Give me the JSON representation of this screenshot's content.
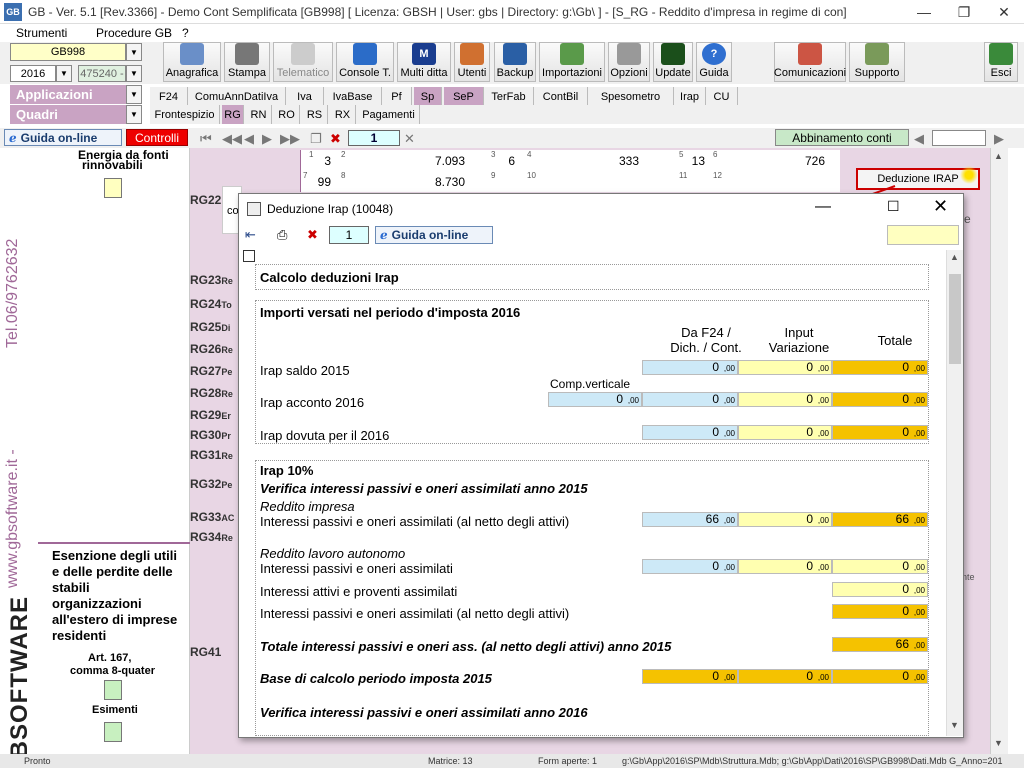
{
  "window": {
    "title": "GB - Ver. 5.1 [Rev.3366] -  Demo Cont Semplificata [GB998]     [ Licenza: GBSH | User: gbs | Directory: g:\\Gb\\ ] - [S_RG - Reddito d'impresa in regime di con]",
    "app_icon_label": "GB",
    "minimize": "—",
    "maximize": "❐",
    "close": "✕"
  },
  "menu": {
    "items": [
      "Strumenti",
      "Procedure GB",
      "?"
    ]
  },
  "left_panel": {
    "company": "GB998",
    "year": "2016",
    "code": "475240 -",
    "sections": [
      "Applicazioni",
      "Quadri"
    ]
  },
  "toolbar": {
    "buttons": [
      "Anagrafica",
      "Stampa",
      "Telematico",
      "Console T.",
      "Multi ditta",
      "Utenti",
      "Backup",
      "Importazioni",
      "Opzioni",
      "Update",
      "Guida",
      "Comunicazioni",
      "Supporto",
      "Esci"
    ]
  },
  "tabs_row1": [
    "F24",
    "ComuAnnDatiIva",
    "Iva",
    "IvaBase",
    "Pf",
    "Sp",
    "SeP",
    "TerFab",
    "ContBil",
    "Spesometro",
    "Irap",
    "CU"
  ],
  "tabs_row2": [
    "Frontespizio",
    "RG",
    "RN",
    "RO",
    "RS",
    "RX",
    "Pagamenti"
  ],
  "navbar": {
    "guida": "Guida on-line",
    "controlli": "Controlli",
    "page": "1",
    "abbinamento": "Abbinamento conti"
  },
  "brand": {
    "phone": "Tel.06/9762632",
    "site": "www.gbsoftware.it -",
    "logo": "GBSOFTWARE"
  },
  "side_panel": {
    "energia": "Energia da fonti",
    "rinnovabili": "rinnovabili",
    "esenzione": "Esenzione degli utili e delle perdite delle stabili organizzazioni all'estero di imprese residenti",
    "art": "Art. 167,",
    "comma": "comma 8-quater",
    "esimenti": "Esimenti"
  },
  "rows": {
    "rg22": "RG22",
    "rg_list": [
      {
        "code": "RG23",
        "lbl": "Re"
      },
      {
        "code": "RG24",
        "lbl": "To"
      },
      {
        "code": "RG25",
        "lbl": "Di"
      },
      {
        "code": "RG26",
        "lbl": "Re"
      },
      {
        "code": "RG27",
        "lbl": "Pe"
      },
      {
        "code": "RG28",
        "lbl": "Re"
      },
      {
        "code": "RG29",
        "lbl": "Er"
      },
      {
        "code": "RG30",
        "lbl": "Pr"
      },
      {
        "code": "RG31",
        "lbl": "Re"
      },
      {
        "code": "RG32",
        "lbl": "Pe"
      },
      {
        "code": "RG33",
        "lbl": "AC"
      },
      {
        "code": "RG34",
        "lbl": "Re"
      },
      {
        "code": "RG41",
        "lbl": ""
      }
    ],
    "grid_row1": [
      "3",
      "7.093",
      "6",
      "333",
      "13",
      "726"
    ],
    "grid_row2": [
      "99",
      "8.730",
      "",
      "",
      "",
      ""
    ],
    "sup1": [
      "1",
      "2",
      "3",
      "4",
      "5",
      "6"
    ],
    "sup2": [
      "7",
      "8",
      "9",
      "10",
      "11",
      "12"
    ],
    "co_frag": "co",
    "se_frag": "se",
    "nte_frag": "nte",
    "deduzione_btn": "Deduzione IRAP"
  },
  "dialog": {
    "title": "Deduzione Irap (10048)",
    "page": "1",
    "guida": "Guida on-line",
    "heading": "Calcolo deduzioni Irap",
    "importi_title": "Importi versati nel periodo d'imposta 2016",
    "col_f24": "Da F24 /",
    "col_f24b": "Dich. / Cont.",
    "col_input": "Input",
    "col_inputb": "Variazione",
    "col_totale": "Totale",
    "comp_verticale": "Comp.verticale",
    "irap_saldo": {
      "label": "Irap saldo 2015",
      "f24": "0",
      "input": "0",
      "tot": "0"
    },
    "irap_acconto": {
      "label": "Irap acconto 2016",
      "comp": "0",
      "f24": "0",
      "input": "0",
      "tot": "0"
    },
    "irap_dovuta": {
      "label": "Irap dovuta per il 2016",
      "f24": "0",
      "input": "0",
      "tot": "0"
    },
    "irap10": "Irap 10%",
    "verifica2015": "Verifica interessi passivi e oneri assimilati anno 2015",
    "reddito_impresa": "Reddito impresa",
    "int_netto": {
      "label": "Interessi passivi e oneri assimilati (al netto degli attivi)",
      "f24": "66",
      "input": "0",
      "tot": "66"
    },
    "reddito_lavoro": "Reddito lavoro autonomo",
    "int_pass": {
      "label": "Interessi passivi e oneri assimilati",
      "f24": "0",
      "input": "0",
      "tot": "0"
    },
    "int_attivi": {
      "label": "Interessi attivi e proventi assimilati",
      "tot": "0"
    },
    "int_netto2": {
      "label": "Interessi passivi e oneri assimilati (al netto degli attivi)",
      "tot": "0"
    },
    "totale2015": {
      "label": "Totale interessi passivi e oneri ass. (al netto degli attivi) anno 2015",
      "tot": "66"
    },
    "base2015": {
      "label": "Base di calcolo periodo imposta 2015",
      "f24": "0",
      "input": "0",
      "tot": "0"
    },
    "verifica2016": "Verifica interessi passivi e oneri assimilati anno 2016"
  },
  "status": {
    "left": "Pronto",
    "matrice": "Matrice: 13",
    "form": "Form aperte: 1",
    "path": "g:\\Gb\\App\\2016\\SP\\Mdb\\Struttura.Mdb; g:\\Gb\\App\\Dati\\2016\\SP\\GB998\\Dati.Mdb  G_Anno=201"
  }
}
